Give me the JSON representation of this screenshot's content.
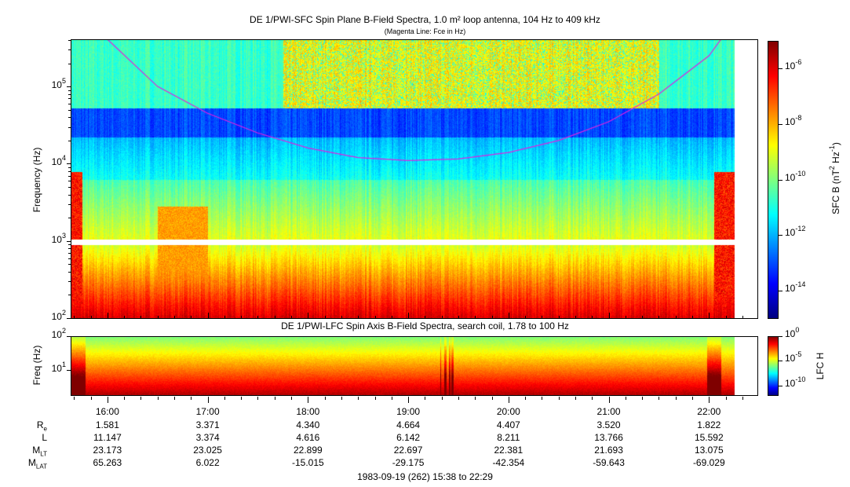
{
  "chart_data": [
    {
      "type": "heatmap",
      "title": "DE 1/PWI-SFC  Spin Plane B-Field Spectra, 1.0 m² loop antenna, 104 Hz to 409 kHz",
      "subtitle": "(Magenta Line: Fce in Hz)",
      "ylabel": "Frequency (Hz)",
      "ylim_hz": [
        100,
        409000
      ],
      "yscale": "log",
      "ytick_exponents": [
        2,
        3,
        4,
        5
      ],
      "xlim_hours": [
        15.633,
        22.483
      ],
      "data_end_hours": 22.25,
      "gap_hz": [
        900,
        1050
      ],
      "colorbar": {
        "label": "SFC B (nT2 Hz-1)",
        "label_main": "SFC B (nT",
        "label_mid": " Hz",
        "range_exp": [
          -15,
          -5
        ],
        "tick_exponents": [
          -6,
          -8,
          -10,
          -12,
          -14
        ]
      },
      "fce_line": {
        "color": "#e020e0",
        "points_hours_hz": [
          [
            16.0,
            409000
          ],
          [
            16.5,
            100000
          ],
          [
            17.0,
            45000
          ],
          [
            17.5,
            25000
          ],
          [
            18.0,
            16000
          ],
          [
            18.5,
            12000
          ],
          [
            19.0,
            11000
          ],
          [
            19.5,
            11500
          ],
          [
            20.0,
            14000
          ],
          [
            20.5,
            20000
          ],
          [
            21.0,
            35000
          ],
          [
            21.5,
            80000
          ],
          [
            22.0,
            250000
          ],
          [
            22.12,
            409000
          ]
        ]
      }
    },
    {
      "type": "heatmap",
      "title": "DE 1/PWI-LFC  Spin Axis B-Field Spectra, search coil, 1.78 to 100 Hz",
      "ylabel": "Freq (Hz)",
      "ylim_hz": [
        1.78,
        100
      ],
      "yscale": "log",
      "ytick_exponents": [
        1,
        2
      ],
      "colorbar": {
        "label": "LFC H",
        "range_exp": [
          -12,
          0
        ],
        "tick_exponents": [
          0,
          -5,
          -10
        ]
      }
    }
  ],
  "time_axis": {
    "ticks": [
      "16:00",
      "17:00",
      "18:00",
      "19:00",
      "20:00",
      "21:00",
      "22:00"
    ],
    "tick_hours": [
      16,
      17,
      18,
      19,
      20,
      21,
      22
    ]
  },
  "ephemeris": [
    {
      "label": "R",
      "sub": "e",
      "values": [
        "1.581",
        "3.371",
        "4.340",
        "4.664",
        "4.407",
        "3.520",
        "1.822"
      ]
    },
    {
      "label": "L",
      "sub": "",
      "values": [
        "11.147",
        "3.374",
        "4.616",
        "6.142",
        "8.211",
        "13.766",
        "15.592"
      ]
    },
    {
      "label": "M",
      "sub": "LT",
      "values": [
        "23.173",
        "23.025",
        "22.899",
        "22.697",
        "22.381",
        "21.693",
        "13.075"
      ]
    },
    {
      "label": "M",
      "sub": "LAT",
      "values": [
        "65.263",
        "6.022",
        "-15.015",
        "-29.175",
        "-42.354",
        "-59.643",
        "-69.029"
      ]
    }
  ],
  "footer": "1983-09-19 (262) 15:38 to 22:29"
}
